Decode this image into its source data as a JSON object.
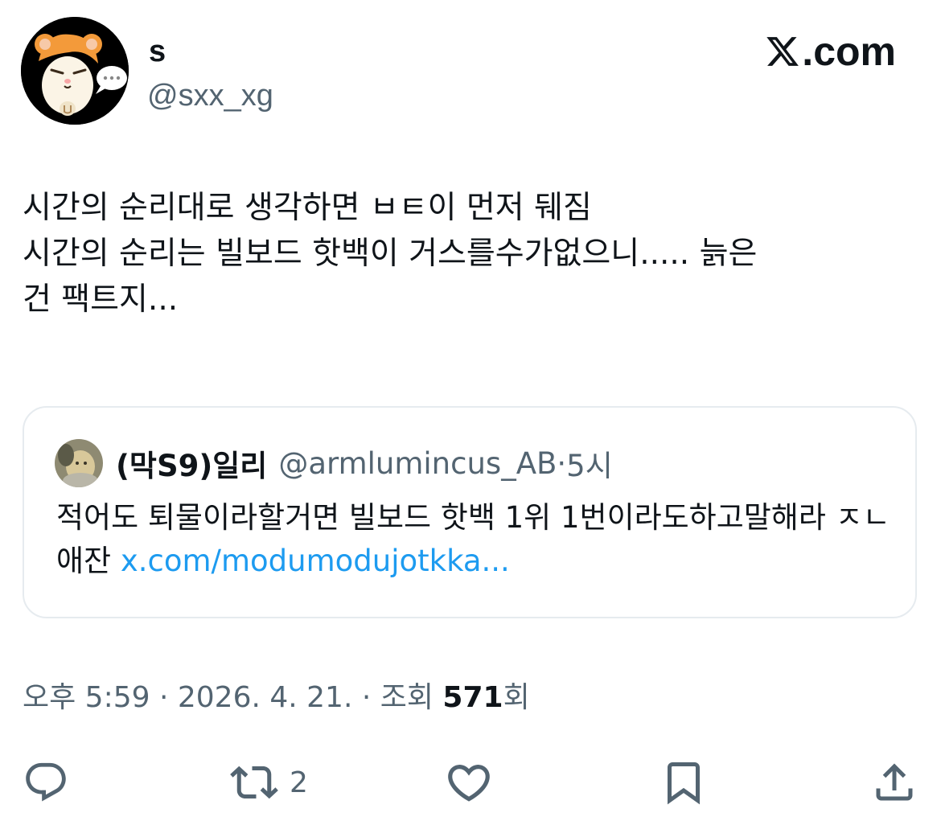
{
  "author": {
    "display_name": "s",
    "handle": "@sxx_xg"
  },
  "brand": {
    "logo_text": ".com"
  },
  "tweet": {
    "text": "시간의 순리대로 생각하면 ㅂㅌ이 먼저 뒈짐\n시간의 순리는 빌보드 핫백이 거스를수가없으니..... 늙은\n건 팩트지..."
  },
  "quote": {
    "name": "(막S9)일리",
    "handle": "@armlumincus_AB",
    "separator": "·",
    "time": "5시",
    "text": "적어도 퇴물이라할거면 빌보드 핫백 1위 1번이라도하고말해라 ㅈㄴ 애잔 ",
    "link_text": "x.com/modumodujotkka..."
  },
  "meta": {
    "timestamp": "오후 5:59 · 2026. 4. 21. · 조회 ",
    "views_count": "571",
    "views_suffix": "회"
  },
  "actions": {
    "reply_icon": "reply-icon",
    "retweet_icon": "retweet-icon",
    "retweet_count": "2",
    "like_icon": "heart-icon",
    "bookmark_icon": "bookmark-icon",
    "share_icon": "share-icon"
  },
  "colors": {
    "text_primary": "#0f1419",
    "text_secondary": "#536471",
    "link": "#1d9bf0",
    "border": "#e6ebef"
  }
}
